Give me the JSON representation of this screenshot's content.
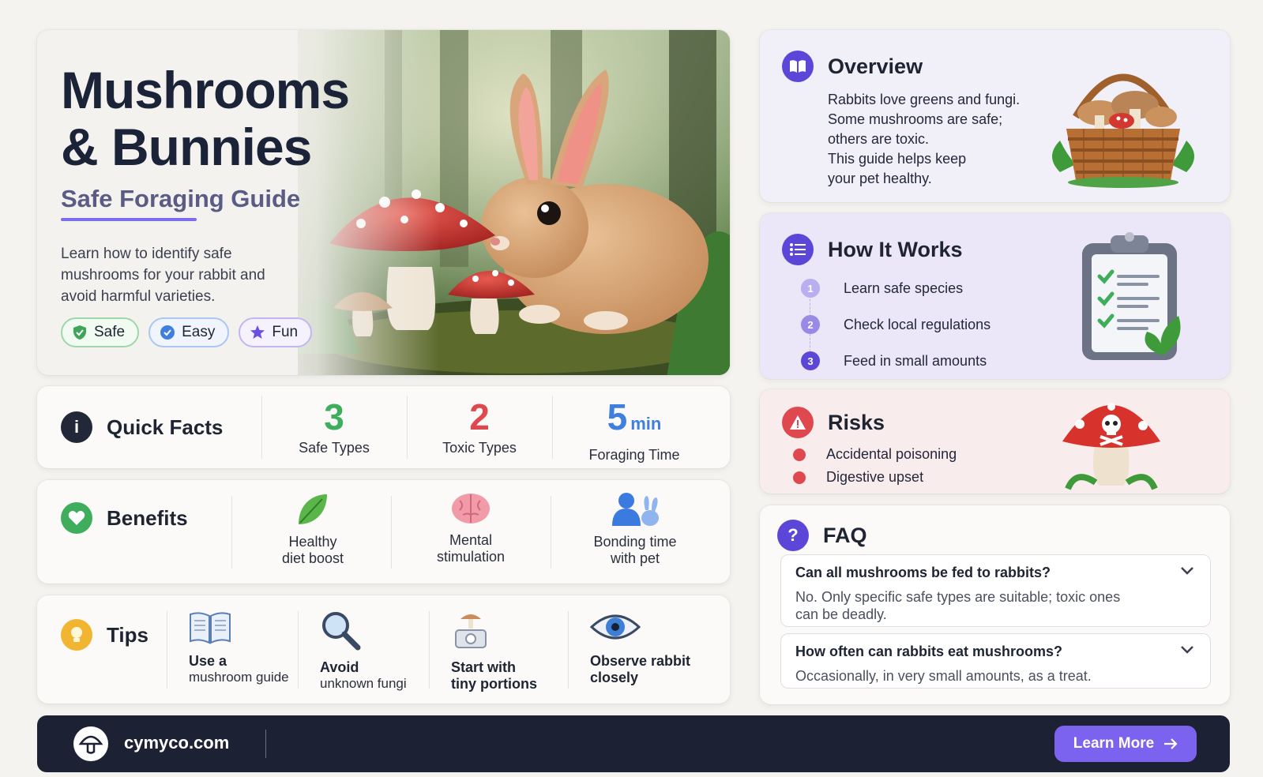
{
  "hero": {
    "title_line1": "Mushrooms",
    "title_line2": "& Bunnies",
    "subtitle": "Safe Foraging Guide",
    "description": "Learn how to identify safe mushrooms for your rabbit and avoid harmful varieties.",
    "pills": [
      {
        "label": "Safe",
        "icon": "shield-check-icon",
        "color": "#3fa55a"
      },
      {
        "label": "Easy",
        "icon": "check-circle-icon",
        "color": "#3f7fe0"
      },
      {
        "label": "Fun",
        "icon": "star-icon",
        "color": "#6b4fe0"
      }
    ]
  },
  "quick_facts": {
    "title": "Quick Facts",
    "items": [
      {
        "number": "3",
        "unit": "",
        "caption": "Safe Types",
        "color": "#3fae5c"
      },
      {
        "number": "2",
        "unit": "",
        "caption": "Toxic Types",
        "color": "#e0484f"
      },
      {
        "number": "5",
        "unit": "min",
        "caption": "Foraging Time",
        "color": "#3f7fe0"
      }
    ]
  },
  "benefits": {
    "title": "Benefits",
    "items": [
      {
        "line1": "Healthy",
        "line2": "diet boost",
        "icon": "leaf-icon"
      },
      {
        "line1": "Mental",
        "line2": "stimulation",
        "icon": "brain-icon"
      },
      {
        "line1": "Bonding time",
        "line2": "with pet",
        "icon": "person-bunny-icon"
      }
    ]
  },
  "tips": {
    "title": "Tips",
    "items": [
      {
        "line1": "Use a",
        "line2": "mushroom guide",
        "icon": "book-icon"
      },
      {
        "line1": "Avoid",
        "line2": "unknown fungi",
        "icon": "magnifier-icon"
      },
      {
        "line1": "Start with",
        "line2": "tiny portions",
        "icon": "scale-icon"
      },
      {
        "line1": "Observe rabbit",
        "line2": "closely",
        "icon": "eye-icon"
      }
    ]
  },
  "overview": {
    "title": "Overview",
    "lines": [
      "Rabbits love greens and fungi.",
      "Some mushrooms are safe;",
      "others are toxic.",
      "This guide helps keep",
      "your pet healthy."
    ]
  },
  "how_it_works": {
    "title": "How It Works",
    "steps": [
      {
        "num": "1",
        "label": "Learn safe species"
      },
      {
        "num": "2",
        "label": "Check local regulations"
      },
      {
        "num": "3",
        "label": "Feed in small amounts"
      }
    ]
  },
  "risks": {
    "title": "Risks",
    "items": [
      "Accidental poisoning",
      "Digestive upset"
    ]
  },
  "faq": {
    "title": "FAQ",
    "items": [
      {
        "question": "Can all mushrooms be fed to rabbits?",
        "answer": "No. Only specific safe types are suitable; toxic ones can be deadly."
      },
      {
        "question": "How often can rabbits eat mushrooms?",
        "answer": "Occasionally, in very small amounts, as a treat."
      }
    ]
  },
  "footer": {
    "site": "cymyco.com",
    "button_label": "Learn More"
  },
  "colors": {
    "accent": "#7b63ef",
    "footer_bg": "#1c2233",
    "toxic": "#e0484f",
    "safe": "#3fae5c",
    "info": "#3f7fe0"
  }
}
